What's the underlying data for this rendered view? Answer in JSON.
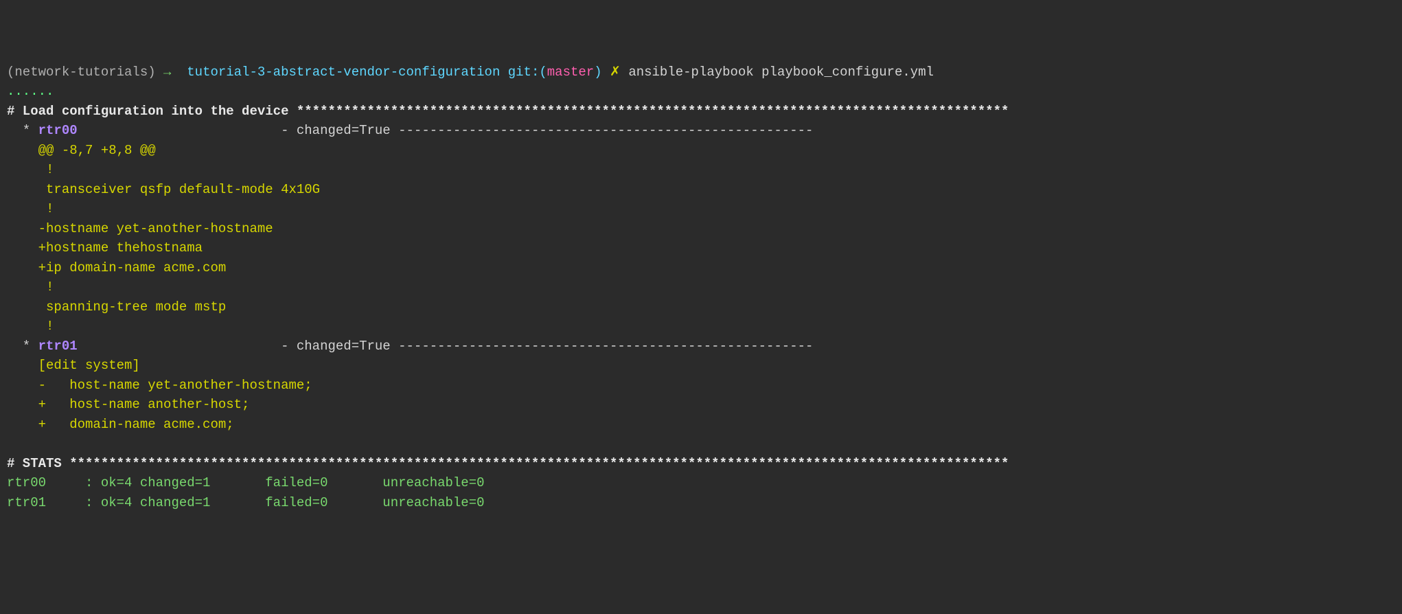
{
  "prompt": {
    "env": "(network-tutorials)",
    "arrow": "→",
    "path": "tutorial-3-abstract-vendor-configuration",
    "git_label": "git:",
    "paren_open": "(",
    "branch": "master",
    "paren_close": ")",
    "x": "✗",
    "command": "ansible-playbook playbook_configure.yml"
  },
  "dots": "......",
  "task_header": "# Load configuration into the device *******************************************************************************************",
  "hosts": {
    "rtr00": {
      "bullet": "  * ",
      "name": "rtr00",
      "pad": "                          ",
      "changed": "- changed=True ",
      "dashes": "-----------------------------------------------------",
      "diff": {
        "hunk": "    @@ -8,7 +8,8 @@",
        "l1": "     !",
        "l2": "     transceiver qsfp default-mode 4x10G",
        "l3": "     !",
        "l4": "    -hostname yet-another-hostname",
        "l5": "    +hostname thehostnama",
        "l6": "    +ip domain-name acme.com",
        "l7": "     !",
        "l8": "     spanning-tree mode mstp",
        "l9": "     !"
      }
    },
    "rtr01": {
      "bullet": "  * ",
      "name": "rtr01",
      "pad": "                          ",
      "changed": "- changed=True ",
      "dashes": "-----------------------------------------------------",
      "diff": {
        "l1": "    [edit system]",
        "l2": "    -   host-name yet-another-hostname;",
        "l3": "    +   host-name another-host;",
        "l4": "    +   domain-name acme.com;"
      }
    }
  },
  "blank": "",
  "stats_header": "# STATS ************************************************************************************************************************",
  "stats": {
    "rtr00": "rtr00     : ok=4 changed=1       failed=0       unreachable=0",
    "rtr01": "rtr01     : ok=4 changed=1       failed=0       unreachable=0"
  }
}
